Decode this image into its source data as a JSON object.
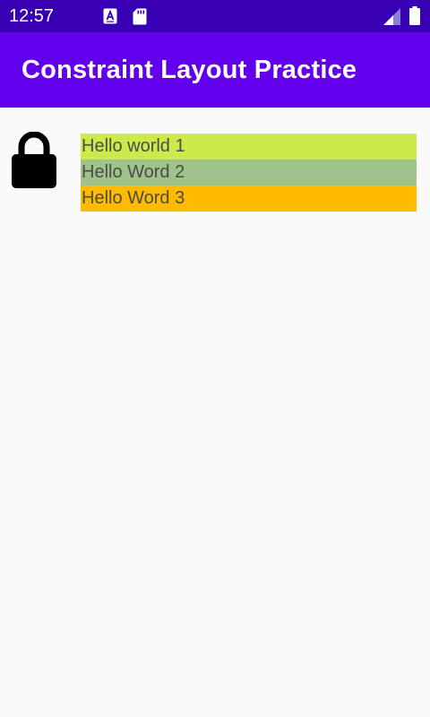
{
  "status_bar": {
    "time": "12:57",
    "icons": [
      "a-notification-icon",
      "sd-card-icon",
      "signal-icon",
      "battery-icon"
    ]
  },
  "app_bar": {
    "title": "Constraint Layout Practice"
  },
  "content": {
    "icon": "lock-icon",
    "rows": [
      {
        "label": "Hello world 1",
        "color": "#cdea4c"
      },
      {
        "label": "Hello Word 2",
        "color": "#9fc38a"
      },
      {
        "label": "Hello Word 3",
        "color": "#ffbb00"
      }
    ]
  },
  "colors": {
    "status_bar": "#3700b3",
    "app_bar": "#6200ee",
    "background": "#fafafa"
  }
}
